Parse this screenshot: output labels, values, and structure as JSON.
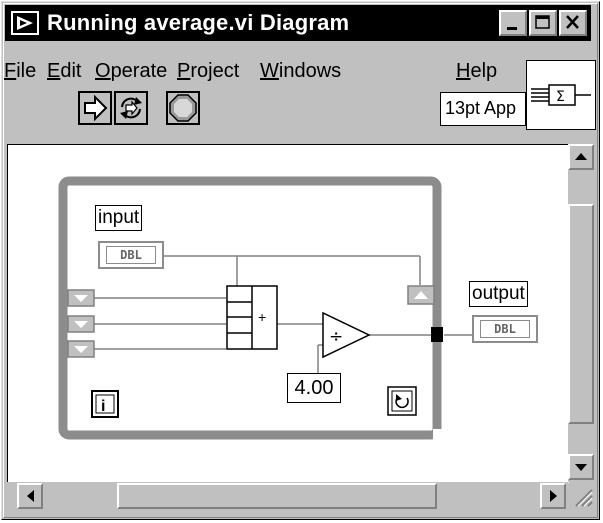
{
  "window": {
    "title": "Running average.vi Diagram"
  },
  "menubar": {
    "items": [
      {
        "key": "F",
        "rest": "ile"
      },
      {
        "key": "E",
        "rest": "dit"
      },
      {
        "key": "O",
        "rest": "perate"
      },
      {
        "key": "P",
        "rest": "roject"
      },
      {
        "key": "W",
        "rest": "indows"
      },
      {
        "key": "H",
        "rest": "elp"
      }
    ]
  },
  "toolbar": {
    "font_ring": "13pt App"
  },
  "diagram": {
    "input_label": "input",
    "output_label": "output",
    "input_type": "DBL",
    "output_type": "DBL",
    "constant": "4.00",
    "add_symbol": "+",
    "iteration_terminal": "i",
    "divide_symbol": "÷"
  },
  "icons": {
    "run": "run-arrow-icon",
    "run_continuously": "run-continuously-icon",
    "abort": "abort-icon",
    "vi_icon": "sum-vi-icon"
  },
  "colors": {
    "frame": "#8c8c8c",
    "wire": "#808080",
    "title_bar": "#000000"
  }
}
